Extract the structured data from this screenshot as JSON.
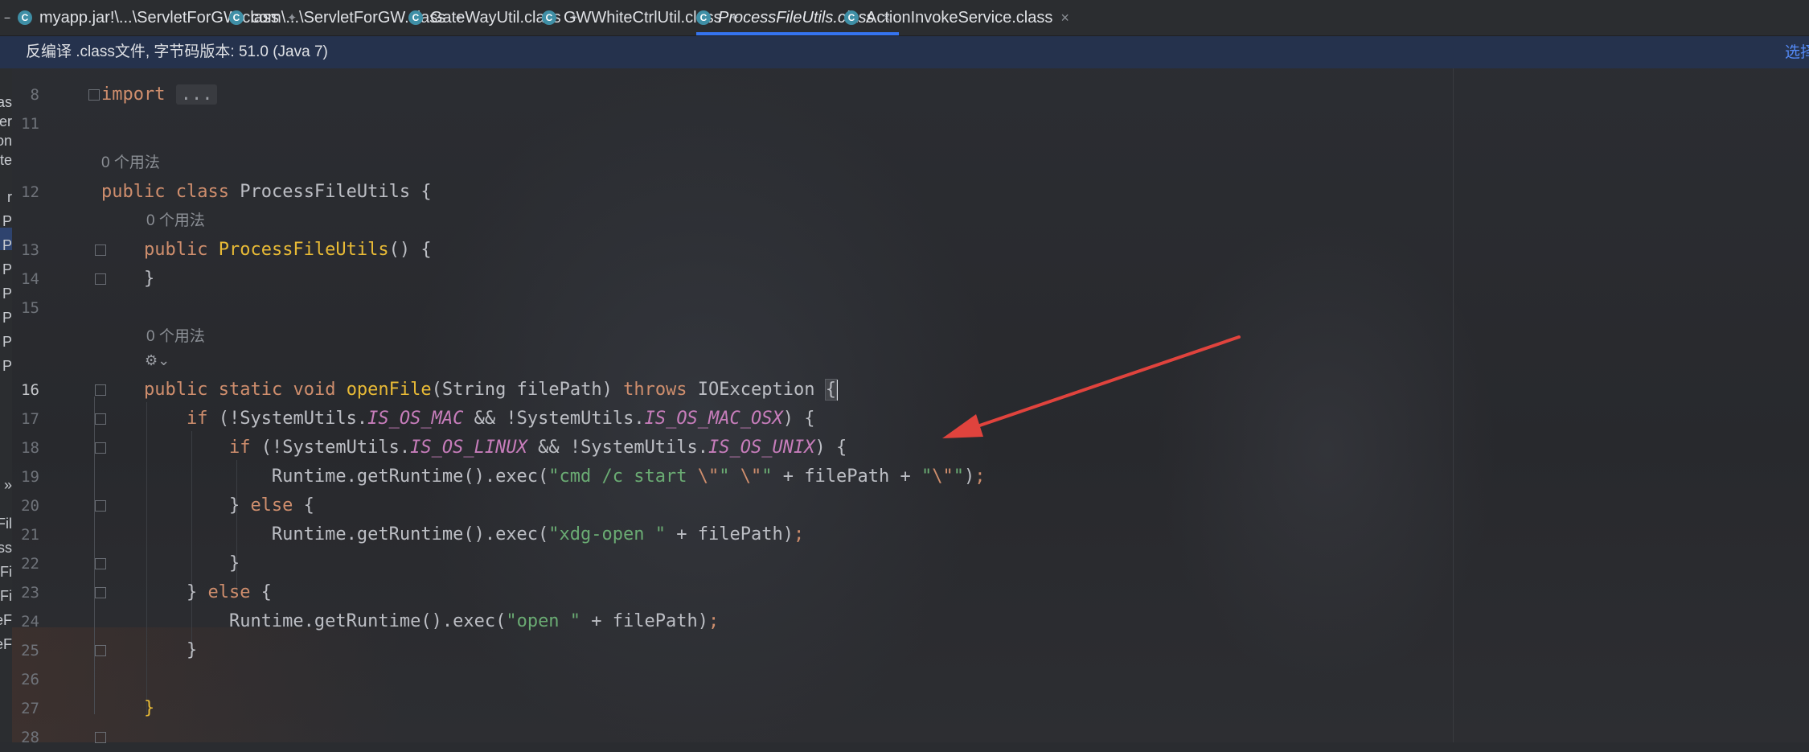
{
  "tabs": [
    {
      "label": "myapp.jar!\\...\\ServletForGW.class",
      "pinned": true,
      "active": false
    },
    {
      "label": "com\\...\\ServletForGW.class",
      "pinned": true,
      "active": false
    },
    {
      "label": "GateWayUtil.class",
      "pinned": true,
      "active": false
    },
    {
      "label": "GWWhiteCtrlUtil.class",
      "pinned": true,
      "active": false
    },
    {
      "label": "ProcessFileUtils.class",
      "pinned": false,
      "active": true
    },
    {
      "label": "ActionInvokeService.class",
      "pinned": false,
      "active": false
    }
  ],
  "tab_icon_letter": "C",
  "tab_icon_color": "#3f8fa6",
  "notice": {
    "text": "反编译 .class文件, 字节码版本: 51.0 (Java 7)",
    "link": "选择"
  },
  "project_panel": {
    "items": [
      "as",
      "er",
      "on",
      "te",
      "r",
      "P",
      "P",
      "P",
      "P",
      "P",
      "P",
      "P",
      "»",
      "Fil",
      "ess",
      "Fi",
      "Fi",
      "eF",
      "eF"
    ]
  },
  "editor": {
    "current_line": 16,
    "usage_hint": "0 个用法",
    "line_numbers": [
      "8",
      "11",
      "12",
      "13",
      "14",
      "15",
      "16",
      "17",
      "18",
      "19",
      "20",
      "21",
      "22",
      "23",
      "24",
      "25",
      "26",
      "27",
      "28"
    ],
    "code": {
      "import_kw": "import",
      "import_folded": "...",
      "class_kw1": "public",
      "class_kw2": "class",
      "class_name": "ProcessFileUtils",
      "ctor_kw": "public",
      "ctor_name": "ProcessFileUtils",
      "method_kw1": "public",
      "method_kw2": "static",
      "method_kw3": "void",
      "method_name": "openFile",
      "method_params": "(String filePath) ",
      "throws_kw": "throws",
      "exception": " IOException ",
      "if_kw": "if",
      "sysutils": "SystemUtils.",
      "c_mac": "IS_OS_MAC",
      "c_mac_osx": "IS_OS_MAC_OSX",
      "c_linux": "IS_OS_LINUX",
      "c_unix": "IS_OS_UNIX",
      "runtime_call": "Runtime.getRuntime().exec(",
      "str_cmd_a": "\"cmd /c start ",
      "str_cmd_esc1": "\\\"",
      "str_cmd_b": "\" ",
      "str_cmd_esc2": "\\\"",
      "str_cmd_c": "\"",
      "file_path": "filePath",
      "str_q_open": "\"",
      "str_q_esc": "\\\"",
      "str_q_close": "\"",
      "str_xdg": "\"xdg-open \"",
      "str_open": "\"open \"",
      "else_kw": "else"
    }
  },
  "annotation_arrow_color": "#e0433d"
}
